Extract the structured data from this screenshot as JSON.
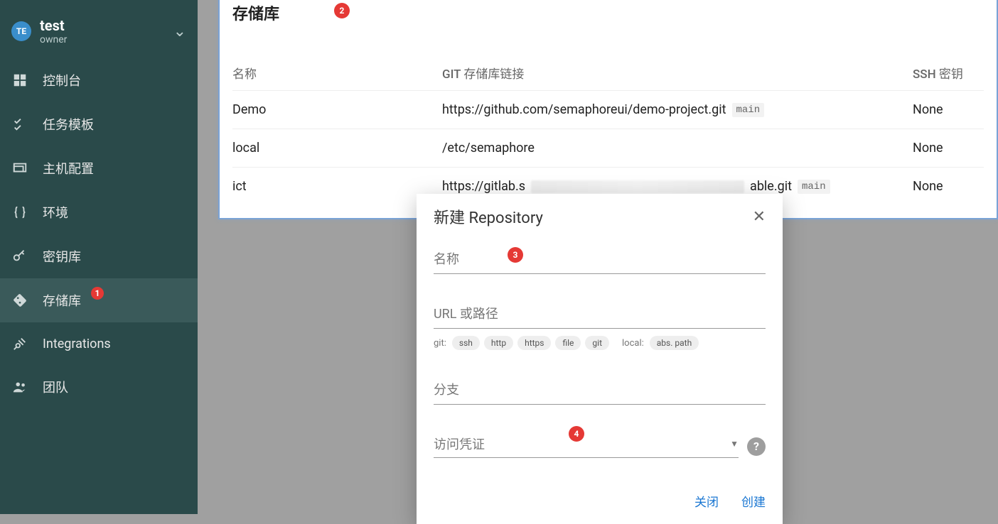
{
  "sidebar": {
    "avatar_initials": "TE",
    "project_name": "test",
    "project_role": "owner",
    "items": [
      {
        "label": "控制台"
      },
      {
        "label": "任务模板"
      },
      {
        "label": "主机配置"
      },
      {
        "label": "环境"
      },
      {
        "label": "密钥库"
      },
      {
        "label": "存储库",
        "badge": "1"
      },
      {
        "label": "Integrations"
      },
      {
        "label": "团队"
      }
    ]
  },
  "panel": {
    "title": "存储库",
    "columns": {
      "name": "名称",
      "link": "GIT 存储库链接",
      "ssh": "SSH 密钥"
    },
    "rows": [
      {
        "name": "Demo",
        "link": "https://github.com/semaphoreui/demo-project.git",
        "branch": "main",
        "ssh": "None"
      },
      {
        "name": "local",
        "link": "/etc/semaphore",
        "branch": "",
        "ssh": "None"
      },
      {
        "name": "ict",
        "link_prefix": "https://gitlab.s",
        "link_suffix": "able.git",
        "branch": "main",
        "ssh": "None"
      }
    ]
  },
  "shadow_row": {
    "name": "ict",
    "branch": "main",
    "ssh": "None"
  },
  "dialog": {
    "title": "新建 Repository",
    "fields": {
      "name_label": "名称",
      "url_label": "URL 或路径",
      "branch_label": "分支",
      "cred_label": "访问凭证"
    },
    "url_hints": {
      "git_label": "git:",
      "git_chips": [
        "ssh",
        "http",
        "https",
        "file",
        "git"
      ],
      "local_label": "local:",
      "local_chips": [
        "abs. path"
      ]
    },
    "close_label": "关闭",
    "create_label": "创建"
  },
  "annotations": {
    "a1": "1",
    "a2": "2",
    "a3": "3",
    "a4": "4"
  }
}
